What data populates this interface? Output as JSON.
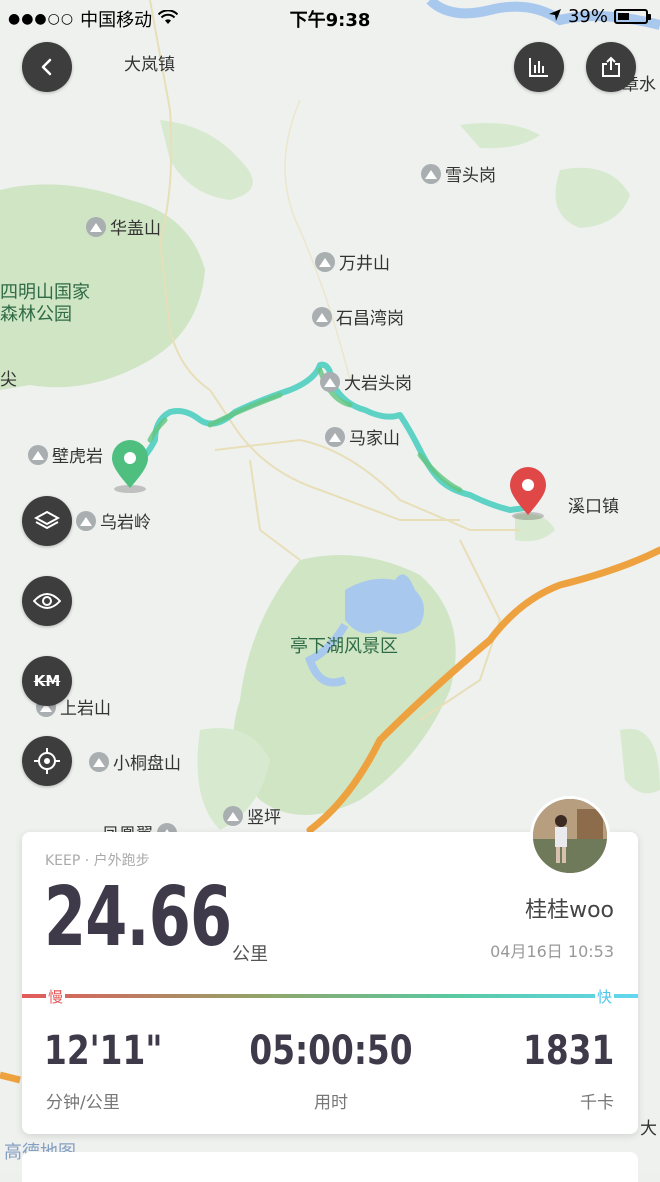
{
  "status_bar": {
    "signal": "●●●○○",
    "carrier": "中国移动",
    "time": "下午9:38",
    "battery": "39%"
  },
  "map": {
    "labels": {
      "dalanzhen": "大岚镇",
      "huagaishan": "华盖山",
      "xuetougang": "雪头岗",
      "wanjingshan": "万井山",
      "shichangwangang": "石昌湾岗",
      "dayantougang": "大岩头岗",
      "majiashan": "马家山",
      "bihuyan": "壁虎岩",
      "wuyanling": "乌岩岭",
      "xikouzhen": "溪口镇",
      "shangyanshan": "上岩山",
      "xiaotongpanshan": "小桐盘山",
      "shuping": "竖坪",
      "fenghuangchi": "凤凰翼",
      "zhangshui": "章水",
      "siming_park_line1": "四明山国家",
      "siming_park_line2": "森林公园",
      "tingxia_lake": "亭下湖风景区",
      "edge_char": "尖",
      "edge_char_right": "大",
      "amap_watermark": "高德地图"
    }
  },
  "controls": {
    "back": "back",
    "stats": "chart",
    "share": "share",
    "layers": "layers",
    "eye": "eye",
    "km_label": "KM",
    "locate": "locate"
  },
  "summary": {
    "source": "KEEP · 户外跑步",
    "distance": "24.66",
    "distance_unit": "公里",
    "username": "桂桂woo",
    "datetime": "04月16日 10:53",
    "pace_slow": "慢",
    "pace_fast": "快",
    "pace_value": "12'11\"",
    "pace_label": "分钟/公里",
    "duration_value": "05:00:50",
    "duration_label": "用时",
    "calories_value": "1831",
    "calories_label": "千卡"
  },
  "colors": {
    "route": "#5ed3c5",
    "start_pin": "#4fbf7f",
    "end_pin": "#e04848",
    "highway": "#eea23f",
    "forest": "#cfe5c4",
    "water": "#a9c8ee"
  }
}
